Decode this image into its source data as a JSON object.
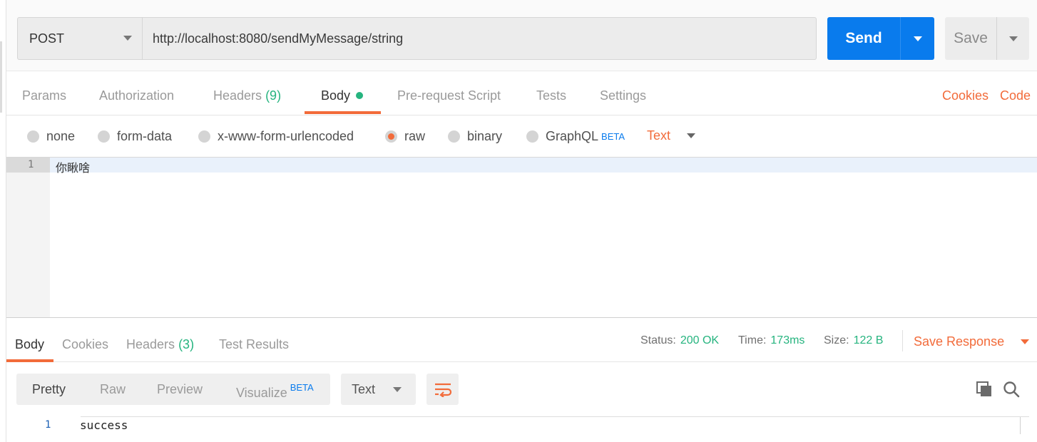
{
  "request": {
    "method": "POST",
    "url": "http://localhost:8080/sendMyMessage/string",
    "send_label": "Send",
    "save_label": "Save"
  },
  "request_tabs": {
    "params": "Params",
    "authorization": "Authorization",
    "headers": "Headers",
    "headers_count": "(9)",
    "body": "Body",
    "pre_request": "Pre-request Script",
    "tests": "Tests",
    "settings": "Settings",
    "cookies": "Cookies",
    "code": "Code"
  },
  "body_types": {
    "none": "none",
    "form_data": "form-data",
    "urlencoded": "x-www-form-urlencoded",
    "raw": "raw",
    "binary": "binary",
    "graphql": "GraphQL",
    "graphql_badge": "BETA",
    "selected": "raw",
    "raw_format": "Text"
  },
  "request_editor": {
    "line_number": "1",
    "line_text": "你瞅啥"
  },
  "response": {
    "tabs": {
      "body": "Body",
      "cookies": "Cookies",
      "headers": "Headers",
      "headers_count": "(3)",
      "test_results": "Test Results"
    },
    "status_label": "Status:",
    "status_value": "200 OK",
    "time_label": "Time:",
    "time_value": "173ms",
    "size_label": "Size:",
    "size_value": "122 B",
    "save_response": "Save Response",
    "view_modes": {
      "pretty": "Pretty",
      "raw": "Raw",
      "preview": "Preview",
      "visualize": "Visualize",
      "visualize_badge": "BETA"
    },
    "format": "Text",
    "line_number": "1",
    "line_text": "success"
  },
  "colors": {
    "accent": "#f26b3a",
    "primary": "#097bed",
    "success": "#26b47f"
  }
}
